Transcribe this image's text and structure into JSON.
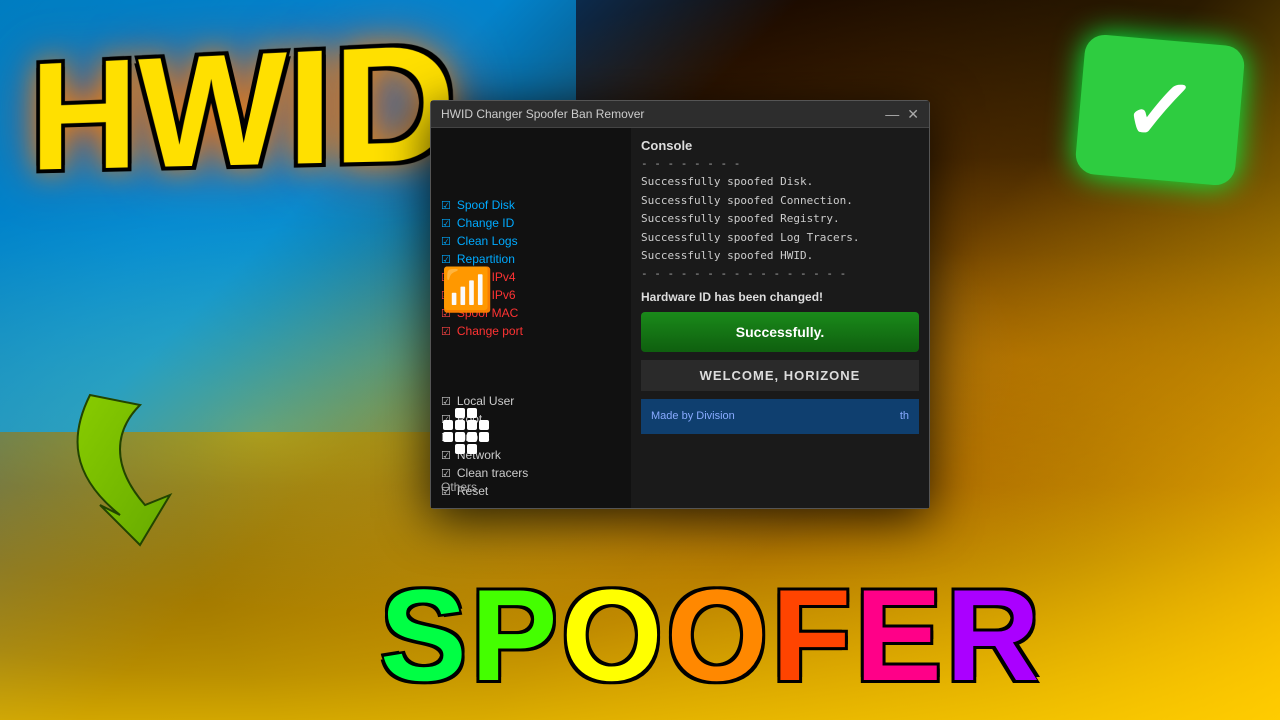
{
  "background": {
    "colors": {
      "fire_yellow": "#FFE000",
      "fire_orange": "#FF8800",
      "blue_teal": "#00AAFF"
    }
  },
  "hwid_title": "HWID",
  "spoofer_text": {
    "letters": [
      "S",
      "P",
      "O",
      "O",
      "F",
      "E",
      "R"
    ]
  },
  "checkmark": {
    "visible": true
  },
  "app_window": {
    "title": "HWID Changer Spoofer Ban Remover",
    "controls": {
      "minimize": "—",
      "close": "✕"
    },
    "left_panel": {
      "checklist": [
        {
          "checked": true,
          "label": "Spoof Disk",
          "style": "blue"
        },
        {
          "checked": true,
          "label": "Change ID",
          "style": "blue"
        },
        {
          "checked": true,
          "label": "Clean Logs",
          "style": "blue"
        },
        {
          "checked": true,
          "label": "Repartition",
          "style": "blue"
        },
        {
          "checked": true,
          "label": "Spoof IPv4",
          "style": "red"
        },
        {
          "checked": true,
          "label": "Spoof IPv6",
          "style": "red"
        },
        {
          "checked": true,
          "label": "Spoof MAC",
          "style": "red"
        },
        {
          "checked": true,
          "label": "Change port",
          "style": "red"
        },
        {
          "checked": true,
          "label": "Local User",
          "style": "white"
        },
        {
          "checked": true,
          "label": "Root",
          "style": "white"
        },
        {
          "checked": true,
          "label": "Public",
          "style": "white"
        },
        {
          "checked": true,
          "label": "Network",
          "style": "white"
        },
        {
          "checked": true,
          "label": "Clean tracers",
          "style": "white"
        },
        {
          "checked": true,
          "label": "Reset",
          "style": "white"
        }
      ],
      "others_label": "Others"
    },
    "right_panel": {
      "console_title": "Console",
      "divider": "- - - - - - - -",
      "logs": [
        "Successfully spoofed Disk.",
        "Successfully spoofed Connection.",
        "Successfully spoofed Registry.",
        "Successfully spoofed Log Tracers.",
        "Successfully spoofed HWID."
      ],
      "divider2": "- - - - - - - - - - - - - - - -",
      "hw_changed": "Hardware ID has been changed!",
      "success_button": "Successfully.",
      "welcome_text": "WELCOME, HORIZONE"
    },
    "footer": {
      "made_by": "Made by Division",
      "discord": "th"
    }
  }
}
